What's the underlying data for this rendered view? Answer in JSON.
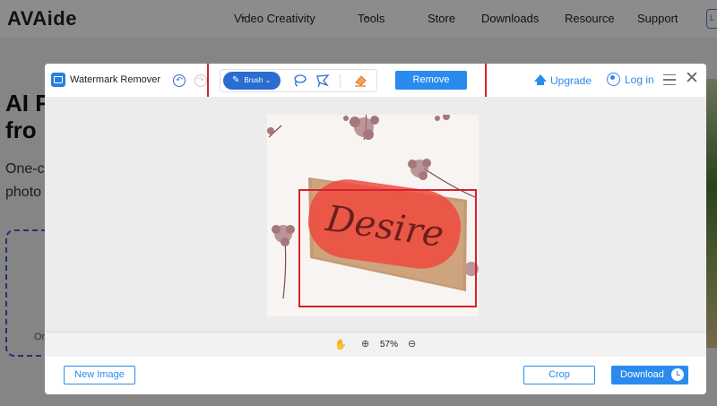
{
  "site": {
    "logo": "AVAide",
    "nav": [
      {
        "label": "Video Creativity",
        "has_dropdown": true
      },
      {
        "label": "Tools",
        "has_dropdown": true
      },
      {
        "label": "Store",
        "has_dropdown": false
      },
      {
        "label": "Downloads",
        "has_dropdown": false
      },
      {
        "label": "Resource",
        "has_dropdown": false
      },
      {
        "label": "Support",
        "has_dropdown": false
      }
    ],
    "nav_extra": "L",
    "hero_title_line1": "AI F",
    "hero_title_line2": "fro",
    "hero_sub_line1": "One-c",
    "hero_sub_line2": "photo",
    "drop_text": "Or"
  },
  "modal": {
    "title": "Watermark Remover",
    "toolbar": {
      "brush_label": "Brush",
      "brush_icon": "brush-icon",
      "lasso_icon": "lasso-icon",
      "polygon_icon": "polygonal-lasso-icon",
      "eraser_icon": "eraser-icon"
    },
    "remove_label": "Remove",
    "upgrade_label": "Upgrade",
    "login_label": "Log in",
    "image": {
      "watermark_text": "Desire"
    },
    "zoom": {
      "value": "57%"
    },
    "footer": {
      "new_image_label": "New Image",
      "crop_label": "Crop",
      "download_label": "Download"
    }
  },
  "colors": {
    "accent": "#2a8bee",
    "brush_active": "#2a6cd0",
    "annotation_red": "#d3222c",
    "highlight": "#f04a3c"
  }
}
